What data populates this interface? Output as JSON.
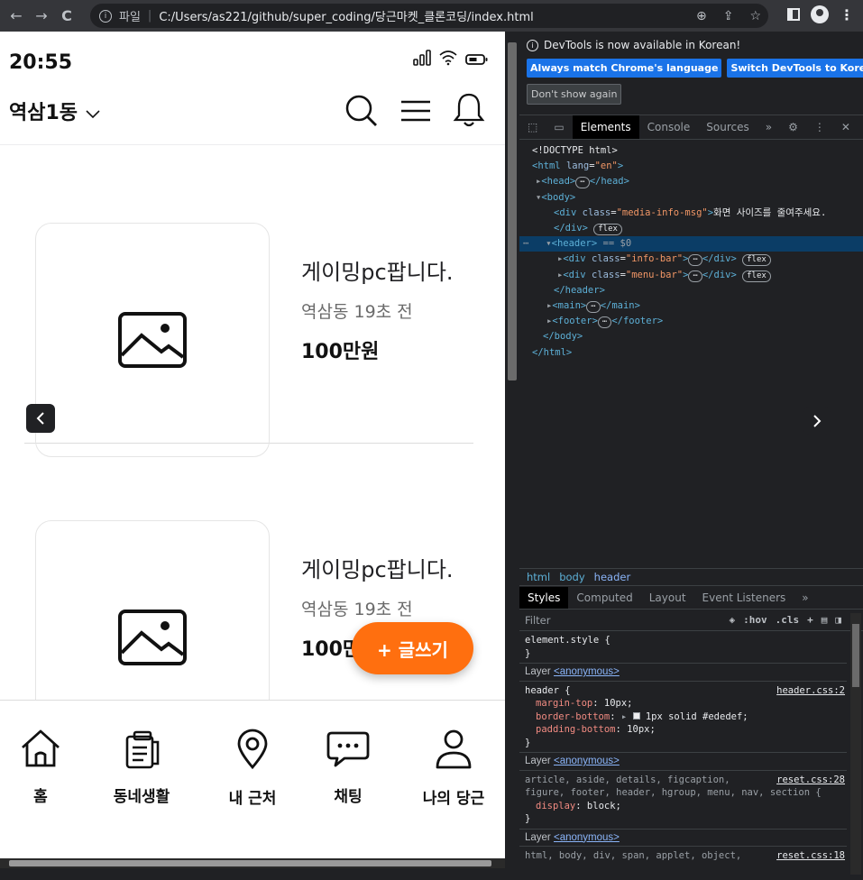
{
  "browser": {
    "url_scheme": "파일",
    "url_path": "C:/Users/as221/github/super_coding/당근마켓_클론코딩/index.html"
  },
  "status": {
    "time": "20:55"
  },
  "header": {
    "location": "역삼1동"
  },
  "items": [
    {
      "title": "게이밍pc팝니다.",
      "meta": "역삼동 19초 전",
      "price": "100만원"
    },
    {
      "title": "게이밍pc팝니다.",
      "meta": "역삼동 19초 전",
      "price": "100만"
    }
  ],
  "fab": {
    "label": "+ 글쓰기"
  },
  "footer": {
    "tabs": [
      {
        "label": "홈",
        "icon": "home-icon"
      },
      {
        "label": "동네생활",
        "icon": "clipboard-icon"
      },
      {
        "label": "내 근처",
        "icon": "location-pin-icon"
      },
      {
        "label": "채팅",
        "icon": "chat-bubble-icon"
      },
      {
        "label": "나의 당근",
        "icon": "user-icon"
      }
    ]
  },
  "devtools": {
    "notice": "DevTools is now available in Korean!",
    "btn_match": "Always match Chrome's language",
    "btn_switch": "Switch DevTools to Korean",
    "btn_dont": "Don't show again",
    "tabs": [
      "Elements",
      "Console",
      "Sources"
    ],
    "crumbs": [
      "html",
      "body",
      "header"
    ],
    "style_tabs": [
      "Styles",
      "Computed",
      "Layout",
      "Event Listeners"
    ],
    "filter_placeholder": "Filter",
    "filter_ops": [
      ":hov",
      ".cls"
    ],
    "element_style": "element.style {",
    "layer_label": "Layer",
    "layer_name": "<anonymous>",
    "rule1": {
      "selector": "header {",
      "source": "header.css:2",
      "props": [
        [
          "margin-top",
          "10px;"
        ],
        [
          "border-bottom",
          "1px solid #ededef;"
        ],
        [
          "padding-bottom",
          "10px;"
        ]
      ]
    },
    "rule2": {
      "selector": "article, aside, details, figcaption,",
      "selector2": "figure, footer, header, hgroup, menu, nav, section {",
      "source": "reset.css:28",
      "props": [
        [
          "display",
          "block;"
        ]
      ]
    },
    "rule3": {
      "selector": "html, body, div, span, applet, object,",
      "source": "reset.css:18"
    },
    "dom": {
      "doctype": "<!DOCTYPE html>",
      "html_open": "<html",
      "lang_attr": "lang",
      "lang_val": "\"en\"",
      "head": "<head>",
      "head_close": "</head>",
      "body": "<body>",
      "div_open": "<div",
      "class_attr": "class",
      "msg_class": "\"media-info-msg\"",
      "msg_text": "화면 사이즈를 줄여주세요.",
      "div_close": "</div>",
      "flex": "flex",
      "header_open": "<header>",
      "sel_marker": "== $0",
      "info_class": "\"info-bar\"",
      "menu_class": "\"menu-bar\"",
      "header_close": "</header>",
      "main_open": "<main>",
      "main_close": "</main>",
      "footer_open": "<footer>",
      "footer_close": "</footer>",
      "body_close": "</body>",
      "html_close": "</html>"
    }
  }
}
